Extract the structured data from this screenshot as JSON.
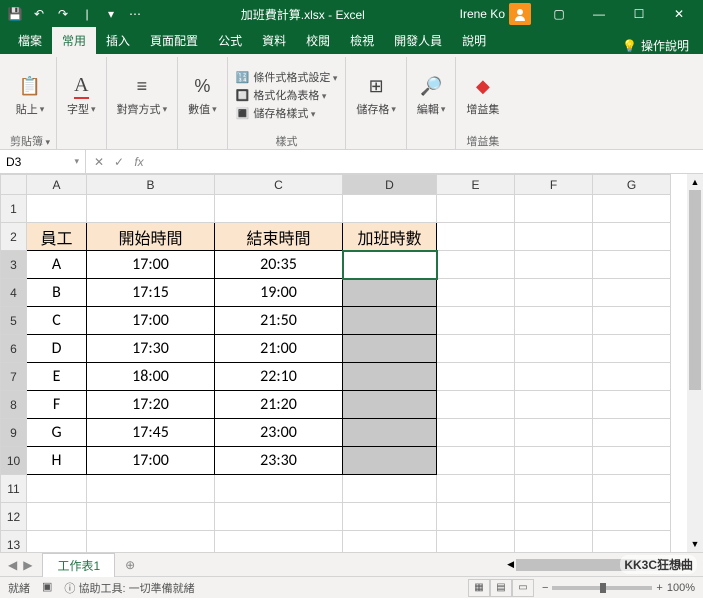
{
  "titlebar": {
    "filename": "加班費計算.xlsx - Excel",
    "user": "Irene Ko"
  },
  "tabs": {
    "file": "檔案",
    "home": "常用",
    "insert": "插入",
    "layout": "頁面配置",
    "formulas": "公式",
    "data": "資料",
    "review": "校閱",
    "view": "檢視",
    "dev": "開發人員",
    "help": "說明",
    "tellme": "操作說明"
  },
  "ribbon": {
    "paste": "貼上",
    "clipboard": "剪貼簿",
    "font": "字型",
    "align": "對齊方式",
    "number": "數值",
    "cond": "條件式格式設定",
    "table": "格式化為表格",
    "cellstyle": "儲存格樣式",
    "styles": "樣式",
    "cells": "儲存格",
    "edit": "編輯",
    "addin": "增益集",
    "addin_g": "增益集"
  },
  "namebox": {
    "ref": "D3",
    "fx": "fx"
  },
  "cols": [
    "A",
    "B",
    "C",
    "D",
    "E",
    "F",
    "G"
  ],
  "headers": {
    "emp": "員工",
    "start": "開始時間",
    "end": "結束時間",
    "ot": "加班時數"
  },
  "rows": [
    {
      "emp": "A",
      "start": "17:00",
      "end": "20:35"
    },
    {
      "emp": "B",
      "start": "17:15",
      "end": "19:00"
    },
    {
      "emp": "C",
      "start": "17:00",
      "end": "21:50"
    },
    {
      "emp": "D",
      "start": "17:30",
      "end": "21:00"
    },
    {
      "emp": "E",
      "start": "18:00",
      "end": "22:10"
    },
    {
      "emp": "F",
      "start": "17:20",
      "end": "21:20"
    },
    {
      "emp": "G",
      "start": "17:45",
      "end": "23:00"
    },
    {
      "emp": "H",
      "start": "17:00",
      "end": "23:30"
    }
  ],
  "sheet": {
    "name": "工作表1"
  },
  "status": {
    "ready": "就緒",
    "acc": "協助工具: 一切準備就緒",
    "zoom": "100%"
  },
  "watermark": "KK3C狂想曲"
}
